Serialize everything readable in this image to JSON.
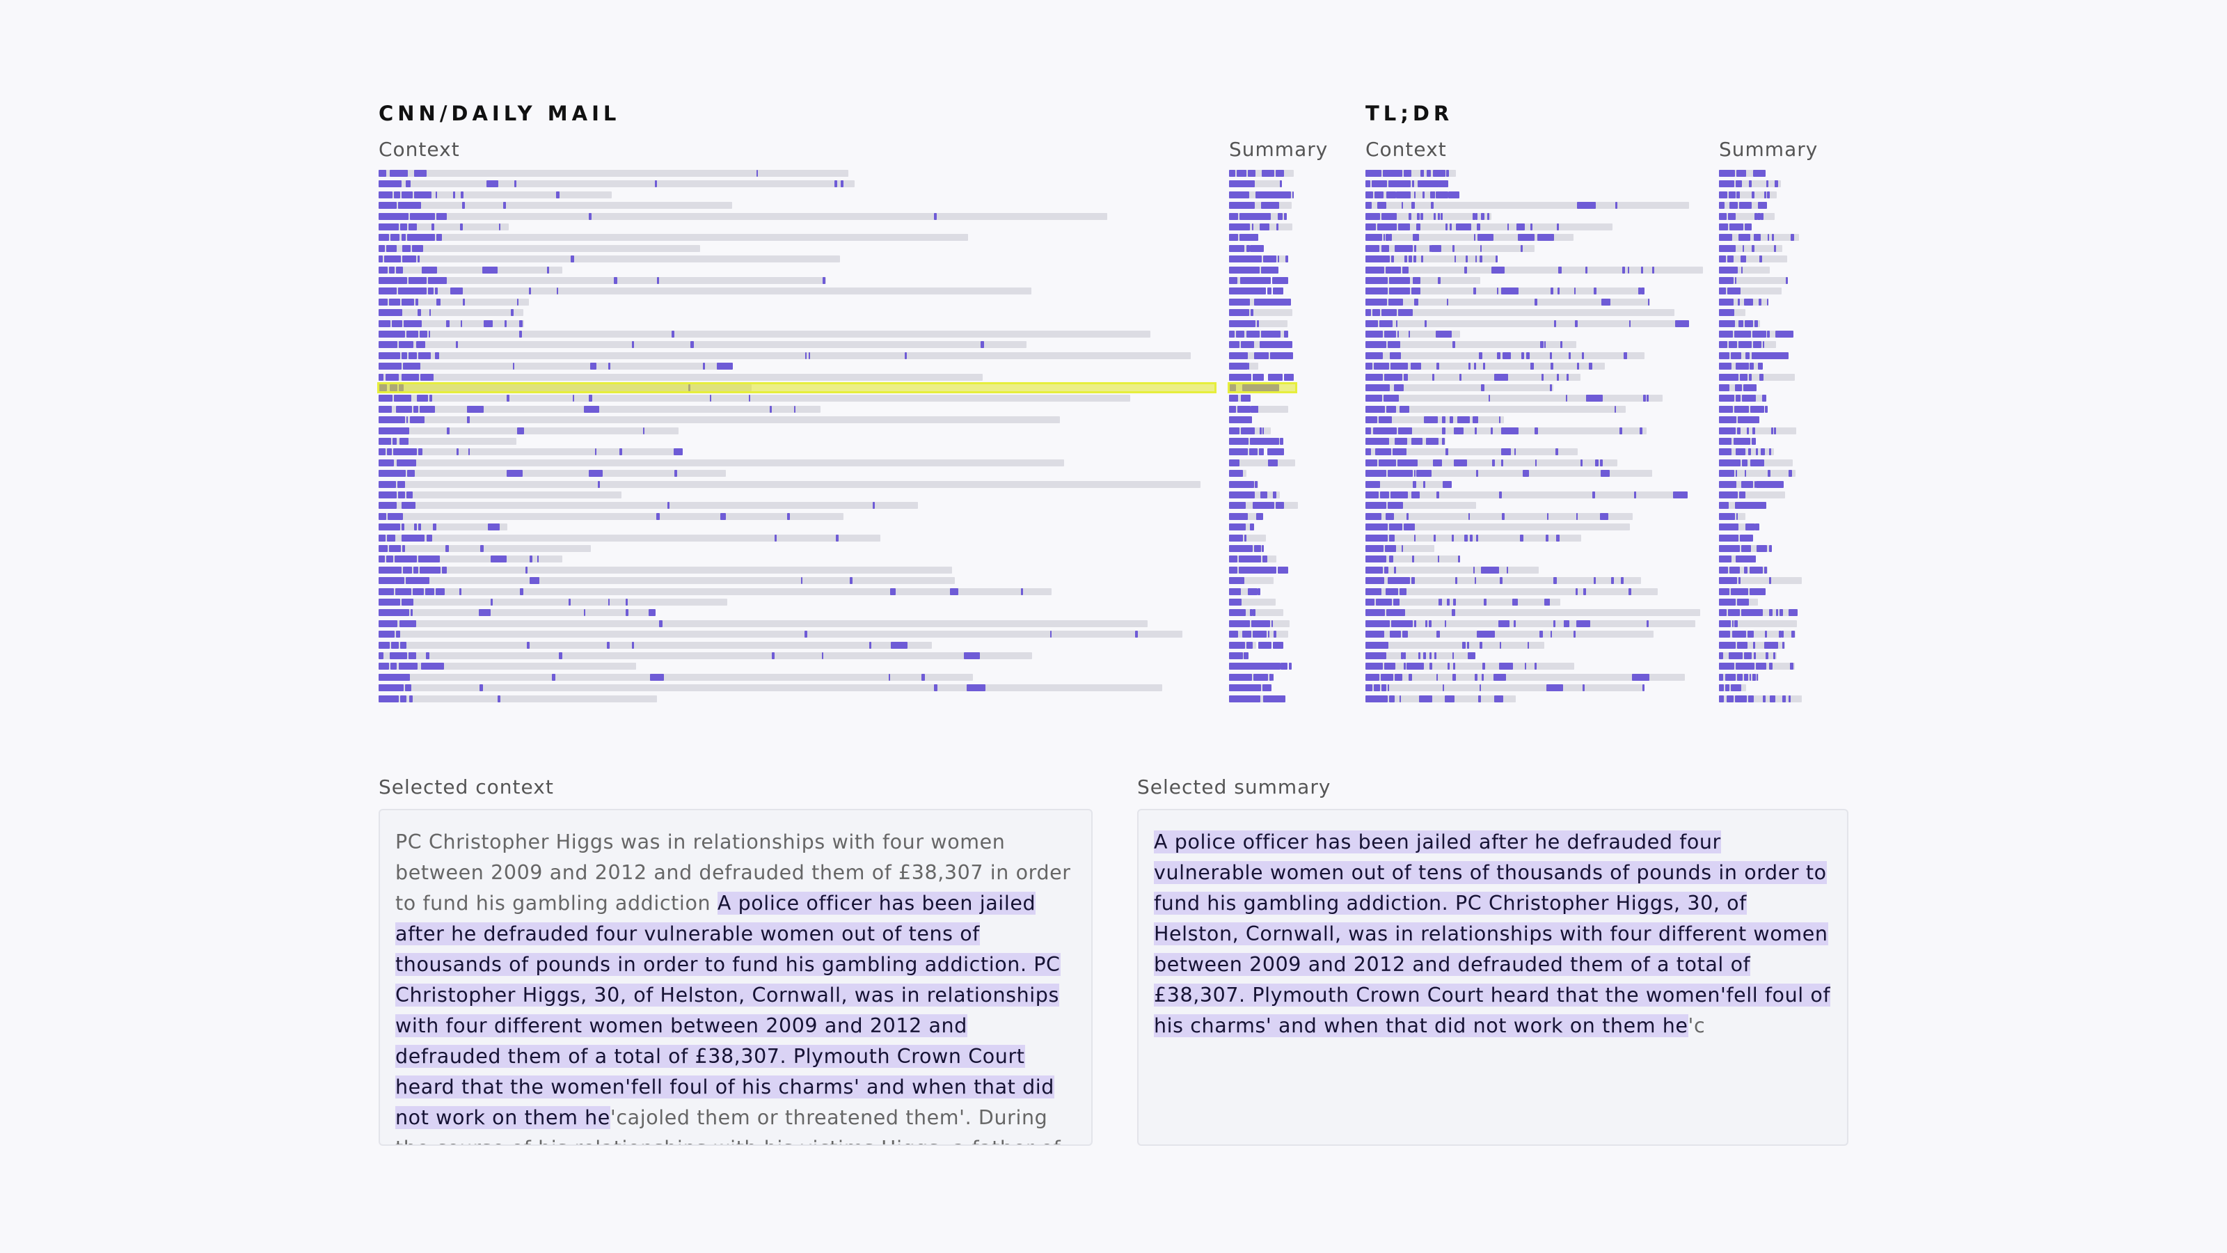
{
  "datasets": [
    {
      "title": "CNN/DAILY MAIL",
      "context_label": "Context",
      "summary_label": "Summary"
    },
    {
      "title": "TL;DR",
      "context_label": "Context",
      "summary_label": "Summary"
    }
  ],
  "selection": {
    "dataset": "CNN/DAILY MAIL",
    "row_index": 20
  },
  "selected_context": {
    "label": "Selected context",
    "before": "PC Christopher Higgs was in relationships with four women between 2009 and 2012 and defrauded them of £38,307 in order to fund his gambling addiction ",
    "highlight": "A police officer has been jailed after he defrauded four vulnerable women out of tens of thousands of pounds in order to fund his gambling addiction. PC Christopher Higgs, 30, of Helston, Cornwall, was in relationships with four different women between 2009 and 2012 and defrauded them of a total of £38,307. Plymouth Crown Court heard that the women'fell foul of his charms' and when that did not work on them he",
    "after": "'cajoled them or threatened them'. During the course of his relationships with his victims Higgs, a father-of-one, would tell"
  },
  "selected_summary": {
    "label": "Selected summary",
    "highlight": "A police officer has been jailed after he defrauded four vulnerable women out of tens of thousands of pounds in order to fund his gambling addiction. PC Christopher Higgs, 30, of Helston, Cornwall, was in relationships with four different women between 2009 and 2012 and defrauded them of a total of £38,307. Plymouth Crown Court heard that the women'fell foul of his charms' and when that did not work on them he",
    "after": "'c"
  },
  "colors": {
    "copied": "#6e5bd6",
    "novel": "#dcdce3",
    "selected_row": "#e6ee3c",
    "text_highlight": "#dad3f5"
  }
}
